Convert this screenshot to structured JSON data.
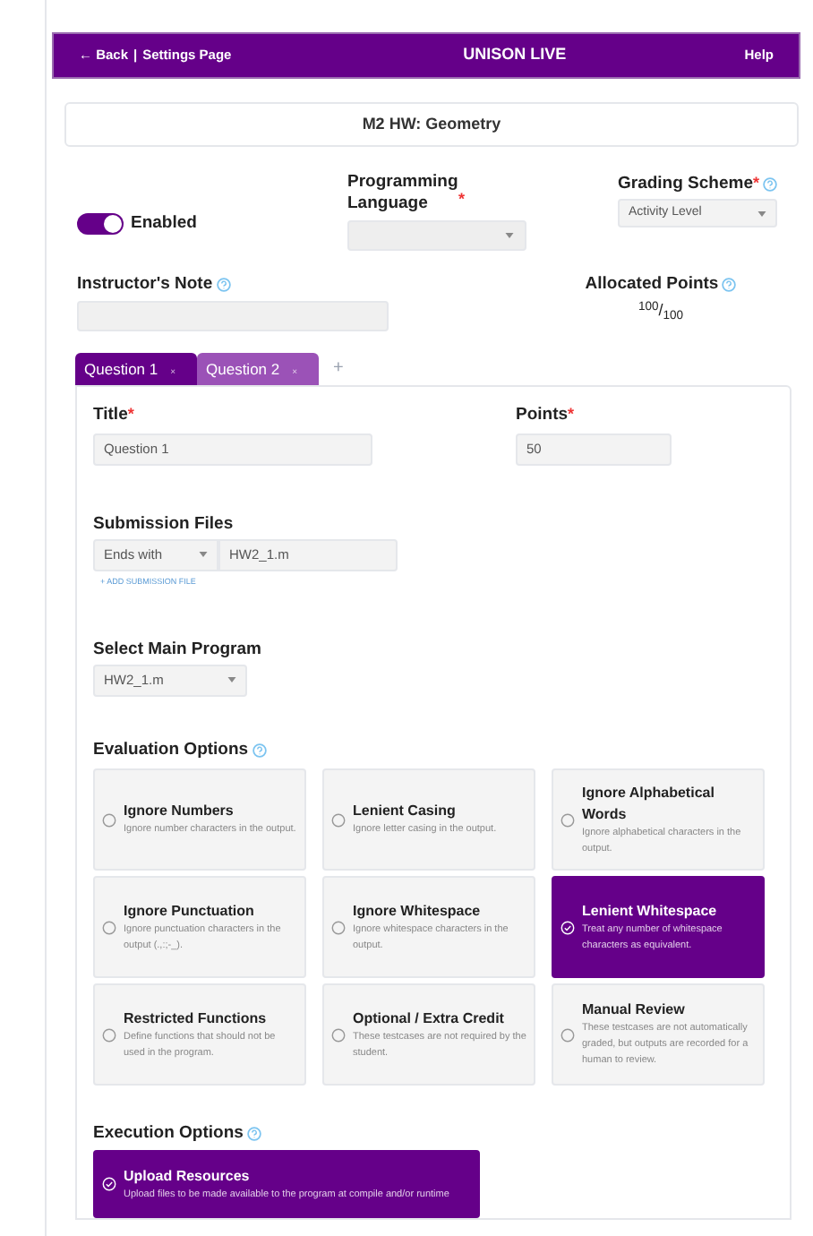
{
  "header": {
    "back": "← Back",
    "separator": "|",
    "settings": "Settings Page",
    "title": "UNISON LIVE",
    "help": "Help"
  },
  "assignment_title": "M2 HW: Geometry",
  "toggle": {
    "label": "Enabled",
    "on": true
  },
  "programming_language": {
    "label": "Programming Language",
    "asterisk": "*"
  },
  "grading_scheme": {
    "label": "Grading Scheme",
    "asterisk": "*",
    "value": "Activity Level"
  },
  "instructors_note": {
    "label": "Instructor's Note"
  },
  "allocated_points": {
    "label": "Allocated Points",
    "value": "$^{100}$/$_{100}$"
  },
  "tabs": [
    {
      "label": "Question 1",
      "close": "×",
      "selected": true
    },
    {
      "label": "Question 2",
      "close": "×",
      "selected": false
    }
  ],
  "add_tab": "+",
  "question": {
    "title_label": "Title",
    "title_asterisk": "*",
    "title_value": "Question 1",
    "points_label": "Points",
    "points_asterisk": "*",
    "points_value": "50",
    "submission_files_label": "Submission Files",
    "match_mode": "Ends with",
    "file_name": "HW2_1.m",
    "add_file": "+ ADD SUBMISSION FILE",
    "main_program_label": "Select Main Program",
    "main_program": "HW2_1.m"
  },
  "evaluation_options": {
    "label": "Evaluation Options",
    "options": [
      {
        "title": "Ignore Numbers",
        "description": "Ignore number characters in the output.",
        "selected": false
      },
      {
        "title": "Lenient Casing",
        "description": "Ignore letter casing in the output.",
        "selected": false
      },
      {
        "title": "Ignore Alphabetical Words",
        "description": "Ignore alphabetical characters in the output.",
        "selected": false
      },
      {
        "title": "Ignore Punctuation",
        "description": "Ignore punctuation characters in the output (.,:;-_).",
        "selected": false
      },
      {
        "title": "Ignore Whitespace",
        "description": "Ignore whitespace characters in the output.",
        "selected": false
      },
      {
        "title": "Lenient Whitespace",
        "description": "Treat any number of whitespace characters as equivalent.",
        "selected": true
      },
      {
        "title": "Restricted Functions",
        "description": "Define functions that should not be used in the program.",
        "selected": false
      },
      {
        "title": "Optional / Extra Credit",
        "description": "These testcases are not required by the student.",
        "selected": false
      },
      {
        "title": "Manual Review",
        "description": "These testcases are not automatically graded, but outputs are recorded for a human to review.",
        "selected": false
      }
    ]
  },
  "execution_options": {
    "label": "Execution Options",
    "options": [
      {
        "title": "Upload Resources",
        "description": "Upload files to be made available to the program at compile and/or runtime",
        "selected": true
      }
    ]
  }
}
